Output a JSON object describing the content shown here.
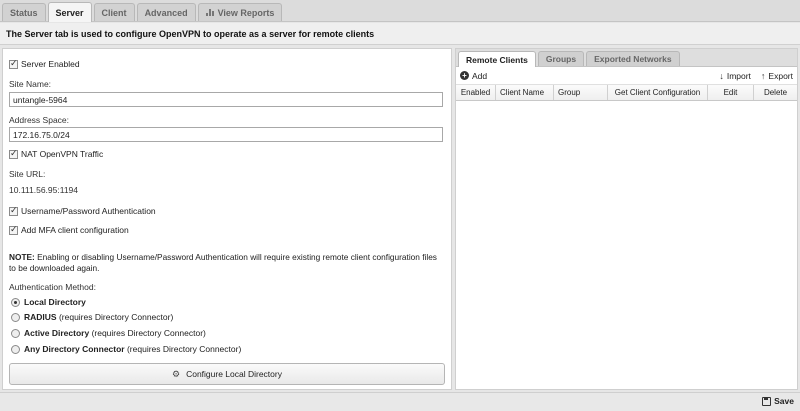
{
  "top_tabs": [
    {
      "label": "Status",
      "active": false
    },
    {
      "label": "Server",
      "active": true
    },
    {
      "label": "Client",
      "active": false
    },
    {
      "label": "Advanced",
      "active": false
    },
    {
      "label": "View Reports",
      "active": false,
      "icon": "bar-chart-icon"
    }
  ],
  "intro": "The Server tab is used to configure OpenVPN to operate as a server for remote clients",
  "server": {
    "server_enabled_label": "Server Enabled",
    "server_enabled": true,
    "site_name_label": "Site Name:",
    "site_name_value": "untangle-5964",
    "address_space_label": "Address Space:",
    "address_space_value": "172.16.75.0/24",
    "nat_label": "NAT OpenVPN Traffic",
    "nat_enabled": true,
    "site_url_label": "Site URL:",
    "site_url_value": "10.111.56.95:1194",
    "userpass_label": "Username/Password Authentication",
    "userpass_enabled": true,
    "mfa_label": "Add MFA client configuration",
    "mfa_enabled": true,
    "note_prefix": "NOTE:",
    "note_text": " Enabling or disabling Username/Password Authentication will require existing remote client configuration files to be downloaded again.",
    "auth_method_label": "Authentication Method:",
    "auth_methods": [
      {
        "name": "Local Directory",
        "suffix": "",
        "selected": true
      },
      {
        "name": "RADIUS",
        "suffix": " (requires Directory Connector)",
        "selected": false
      },
      {
        "name": "Active Directory",
        "suffix": " (requires Directory Connector)",
        "selected": false
      },
      {
        "name": "Any Directory Connector",
        "suffix": " (requires Directory Connector)",
        "selected": false
      }
    ],
    "config_button_label": "Configure Local Directory",
    "config_button_icon": "gear-icon"
  },
  "clients": {
    "tabs": [
      {
        "label": "Remote Clients",
        "active": true
      },
      {
        "label": "Groups",
        "active": false
      },
      {
        "label": "Exported Networks",
        "active": false
      }
    ],
    "add_label": "Add",
    "import_label": "Import",
    "export_label": "Export",
    "columns": [
      "Enabled",
      "Client Name",
      "Group",
      "Get Client Configuration",
      "Edit",
      "Delete"
    ]
  },
  "footer": {
    "save_label": "Save",
    "save_icon": "floppy-disk-icon"
  }
}
